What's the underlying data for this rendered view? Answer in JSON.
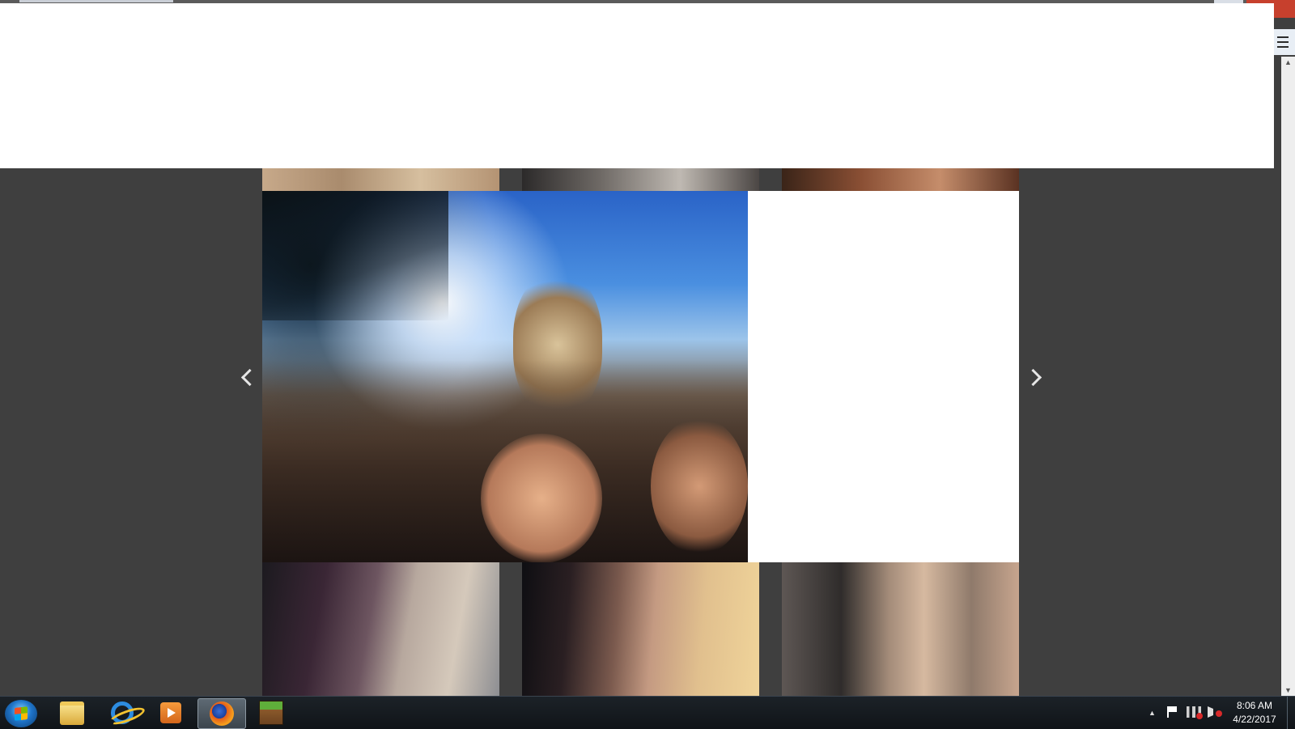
{
  "window": {
    "close_glyph": "✕"
  },
  "browser": {
    "menu_icon": "hamburger-menu-icon"
  },
  "scrollbar": {
    "up_glyph": "▲",
    "down_glyph": "▼"
  },
  "lightbox": {
    "prev_icon": "chevron-left-icon",
    "next_icon": "chevron-right-icon"
  },
  "taskbar": {
    "start_icon": "windows-start-icon",
    "apps": [
      {
        "icon": "file-explorer-icon"
      },
      {
        "icon": "internet-explorer-icon"
      },
      {
        "icon": "media-player-icon"
      },
      {
        "icon": "firefox-icon",
        "active": true
      },
      {
        "icon": "minecraft-icon"
      }
    ],
    "tray": {
      "expand_glyph": "▲",
      "time": "8:06 AM",
      "date": "4/22/2017"
    }
  },
  "colors": {
    "page_background": "#3f3f3f",
    "lightbox_panel": "#ffffff",
    "taskbar": "#101418"
  }
}
